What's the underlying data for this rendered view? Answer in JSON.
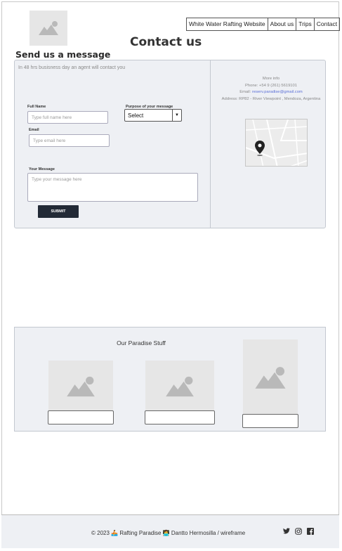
{
  "header": {
    "nav": [
      "White Water Rafting Website",
      "About us",
      "Trips",
      "Contact"
    ],
    "page_title": "Contact us"
  },
  "contact": {
    "section_title": "Send us a message",
    "intro": "In 48 hrs busisness day an agent will contact you",
    "full_name_label": "Full Name",
    "full_name_placeholder": "Type full name here",
    "purpose_label": "Purpose of your message",
    "purpose_value": "Select",
    "email_label": "Email",
    "email_placeholder": "Type email here",
    "message_label": "Your Message",
    "message_placeholder": "Type your message here",
    "submit_label": "SUBMIT"
  },
  "info": {
    "heading": "More info",
    "phone": "Phone: +54 9 (261) 5619101",
    "email_prefix": "Email: ",
    "email": "reserv.paradise@gmail.com",
    "address": "Address: RP82 - River Viewpoint , Mendoza, Argentina"
  },
  "stuff": {
    "title": "Our Paradise Stuff"
  },
  "footer": {
    "copyright": "© 2023 🚣 Rafting Paradise 👩‍💻 Dantto Hermosilla / wireframe"
  },
  "icons": {
    "image_placeholder": "image-placeholder-icon",
    "map_pin": "map-pin-icon",
    "twitter": "twitter-icon",
    "instagram": "instagram-icon",
    "facebook": "facebook-icon"
  }
}
